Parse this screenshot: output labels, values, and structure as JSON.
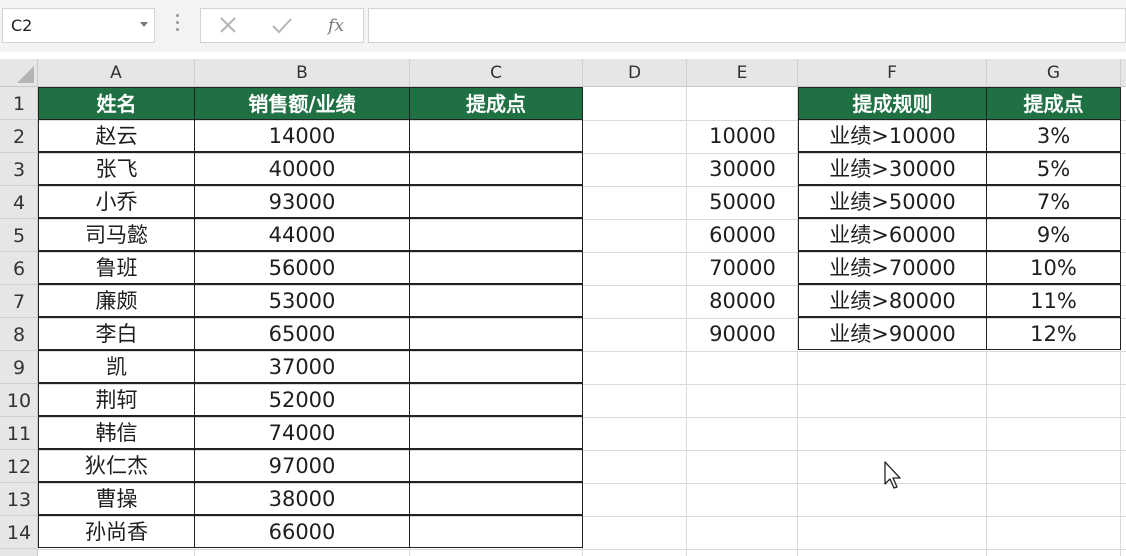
{
  "formula_bar": {
    "name_box": "C2",
    "fx_label": "fx",
    "formula": ""
  },
  "columns": [
    "A",
    "B",
    "C",
    "D",
    "E",
    "F",
    "G"
  ],
  "rows": [
    "1",
    "2",
    "3",
    "4",
    "5",
    "6",
    "7",
    "8",
    "9",
    "10",
    "11",
    "12",
    "13",
    "14"
  ],
  "sales_table": {
    "headers": [
      "姓名",
      "销售额/业绩",
      "提成点"
    ],
    "rows": [
      {
        "name": "赵云",
        "sales": "14000",
        "commission": ""
      },
      {
        "name": "张飞",
        "sales": "40000",
        "commission": ""
      },
      {
        "name": "小乔",
        "sales": "93000",
        "commission": ""
      },
      {
        "name": "司马懿",
        "sales": "44000",
        "commission": ""
      },
      {
        "name": "鲁班",
        "sales": "56000",
        "commission": ""
      },
      {
        "name": "廉颇",
        "sales": "53000",
        "commission": ""
      },
      {
        "name": "李白",
        "sales": "65000",
        "commission": ""
      },
      {
        "name": "凯",
        "sales": "37000",
        "commission": ""
      },
      {
        "name": "荆轲",
        "sales": "52000",
        "commission": ""
      },
      {
        "name": "韩信",
        "sales": "74000",
        "commission": ""
      },
      {
        "name": "狄仁杰",
        "sales": "97000",
        "commission": ""
      },
      {
        "name": "曹操",
        "sales": "38000",
        "commission": ""
      },
      {
        "name": "孙尚香",
        "sales": "66000",
        "commission": ""
      }
    ]
  },
  "threshold_values": [
    "10000",
    "30000",
    "50000",
    "60000",
    "70000",
    "80000",
    "90000"
  ],
  "rule_table": {
    "headers": [
      "提成规则",
      "提成点"
    ],
    "rows": [
      {
        "rule": "业绩>10000",
        "rate": "3%"
      },
      {
        "rule": "业绩>30000",
        "rate": "5%"
      },
      {
        "rule": "业绩>50000",
        "rate": "7%"
      },
      {
        "rule": "业绩>60000",
        "rate": "9%"
      },
      {
        "rule": "业绩>70000",
        "rate": "10%"
      },
      {
        "rule": "业绩>80000",
        "rate": "11%"
      },
      {
        "rule": "业绩>90000",
        "rate": "12%"
      }
    ]
  },
  "colors": {
    "header_fill": "#1f7143",
    "header_text": "#ffffff"
  }
}
